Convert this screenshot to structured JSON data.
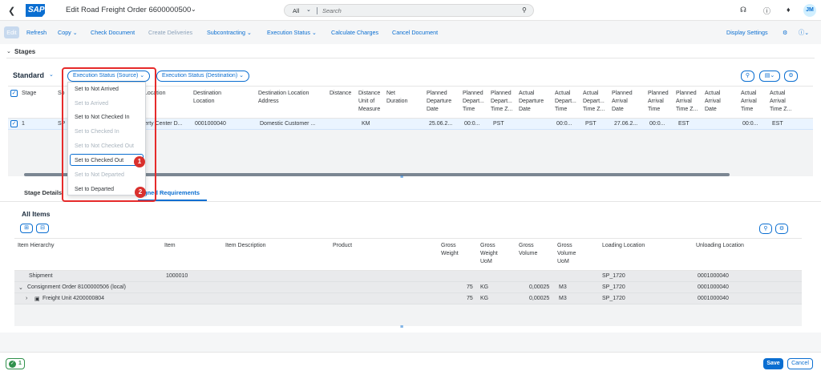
{
  "shell": {
    "title": "Edit Road Freight Order 6600000500",
    "search_scope": "All",
    "search_placeholder": "Search",
    "avatar_initials": "JM"
  },
  "toolbar": {
    "edit": "Edit",
    "refresh": "Refresh",
    "copy": "Copy",
    "check_document": "Check Document",
    "create_deliveries": "Create Deliveries",
    "subcontracting": "Subcontracting",
    "execution_status": "Execution Status",
    "calculate_charges": "Calculate Charges",
    "cancel_document": "Cancel Document",
    "display_settings": "Display Settings"
  },
  "stages": {
    "section_title": "Stages",
    "variant": "Standard",
    "exec_source_btn": "Execution Status (Source)",
    "exec_dest_btn": "Execution Status (Destination)",
    "columns": {
      "stage": "Stage",
      "source_partial": "So",
      "location_partial": "Location",
      "dest_location_1": "Destination",
      "dest_location_2": "Location",
      "dest_address_1": "Destination Location",
      "dest_address_2": "Address",
      "distance": "Distance",
      "distance_uom_1": "Distance",
      "distance_uom_2": "Unit of",
      "distance_uom_3": "Measure",
      "net_duration_1": "Net",
      "net_duration_2": "Duration",
      "pdd_1": "Planned",
      "pdd_2": "Departure",
      "pdd_3": "Date",
      "pdt_1": "Planned",
      "pdt_2": "Depart...",
      "pdt_3": "Time",
      "pdtz_1": "Planned",
      "pdtz_2": "Depart...",
      "pdtz_3": "Time Z...",
      "add_1": "Actual",
      "add_2": "Departure",
      "add_3": "Date",
      "adt_1": "Actual",
      "adt_2": "Depart...",
      "adt_3": "Time",
      "adtz_1": "Actual",
      "adtz_2": "Depart...",
      "adtz_3": "Time Z...",
      "pad_1": "Planned",
      "pad_2": "Arrival",
      "pad_3": "Date",
      "pat_1": "Planned",
      "pat_2": "Arrival",
      "pat_3": "Time",
      "patz_1": "Planned",
      "patz_2": "Arrival",
      "patz_3": "Time Z...",
      "aad_1": "Actual",
      "aad_2": "Arrival",
      "aad_3": "Date",
      "aat_1": "Actual",
      "aat_2": "Arrival",
      "aat_3": "Time",
      "aatz_1": "Actual",
      "aatz_2": "Arrival",
      "aatz_3": "Time Z..."
    },
    "row": {
      "stage": "1",
      "source": "SP",
      "location": "erty Center D...",
      "dest_location": "0001000040",
      "dest_address": "Domestic Customer ...",
      "uom": "KM",
      "pdd": "25.06.2...",
      "pdt": "00:0...",
      "pdtz": "PST",
      "adt": "00:0...",
      "adtz": "PST",
      "pad": "27.06.2...",
      "pat": "00:0...",
      "patz": "EST",
      "aat": "00:0...",
      "aatz": "EST"
    }
  },
  "dropdown": {
    "items": [
      "Set to Not Arrived",
      "Set to Arrived",
      "Set to Not Checked In",
      "Set to Checked In",
      "Set to Not Checked Out",
      "Set to Checked Out",
      "Set to Not Departed",
      "Set to Departed"
    ],
    "step1": "1",
    "step2": "2"
  },
  "tabs": {
    "stage_details": "Stage Details",
    "assigned_requirements": "gned Requirements"
  },
  "items": {
    "title": "All Items",
    "columns": {
      "hierarchy": "Item Hierarchy",
      "item": "Item",
      "description": "Item Description",
      "product": "Product",
      "gw_1": "Gross",
      "gw_2": "Weight",
      "gwu_1": "Gross",
      "gwu_2": "Weight",
      "gwu_3": "UoM",
      "gv_1": "Gross",
      "gv_2": "Volume",
      "gvu_1": "Gross",
      "gvu_2": "Volume",
      "gvu_3": "UoM",
      "loading": "Loading Location",
      "unloading": "Unloading Location"
    },
    "rows": [
      {
        "hierarchy": "Shipment",
        "item": "1000010",
        "gw": "",
        "gwu": "",
        "gv": "",
        "gvu": "",
        "loading": "SP_1720",
        "unloading": "0001000040"
      },
      {
        "hierarchy": "Consignment Order 8100000506 (local)",
        "item": "",
        "gw": "75",
        "gwu": "KG",
        "gv": "0,00025",
        "gvu": "M3",
        "loading": "SP_1720",
        "unloading": "0001000040"
      },
      {
        "hierarchy": "Freight Unit 4200000804",
        "item": "",
        "gw": "75",
        "gwu": "KG",
        "gv": "0,00025",
        "gvu": "M3",
        "loading": "SP_1720",
        "unloading": "0001000040"
      }
    ]
  },
  "footer": {
    "message_count": "1",
    "save": "Save",
    "cancel": "Cancel"
  },
  "colors": {
    "brand": "#0a6ed1",
    "highlight_red": "#e62b2b",
    "success": "#30914c"
  }
}
